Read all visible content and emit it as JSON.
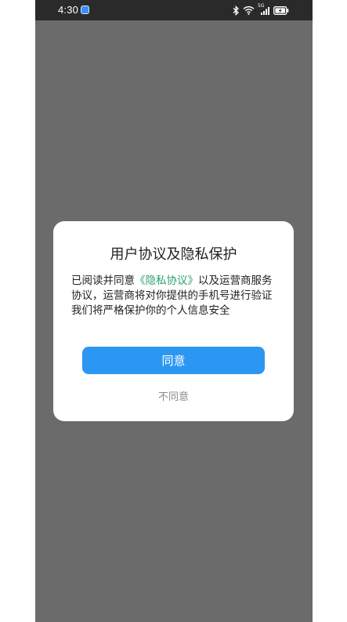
{
  "status_bar": {
    "time": "4:30",
    "network_label": "5G",
    "icons": [
      "app-notification-icon",
      "bluetooth-icon",
      "wifi-icon",
      "cellular-signal-icon",
      "battery-charging-icon"
    ]
  },
  "dialog": {
    "title": "用户协议及隐私保护",
    "body": {
      "prefix": "已阅读并同意",
      "policy_link": "《隐私协议》",
      "suffix": "以及运营商服务协议，运营商将对你提供的手机号进行验证",
      "line2": "我们将严格保护你的个人信息安全"
    },
    "agree_label": "同意",
    "disagree_label": "不同意"
  },
  "colors": {
    "overlay": "#6b6b6b",
    "statusbar": "#2a2a2a",
    "accent": "#2c97f2",
    "link": "#2f9e6e",
    "muted_text": "#8a8a8a"
  }
}
